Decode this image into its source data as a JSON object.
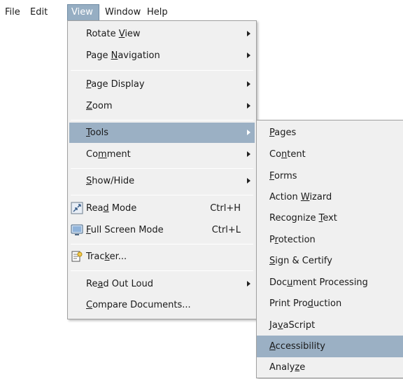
{
  "menubar": {
    "items": [
      {
        "label": "File"
      },
      {
        "label": "Edit"
      },
      {
        "label": "View"
      },
      {
        "label": "Window"
      },
      {
        "label": "Help"
      }
    ]
  },
  "view_menu": {
    "items": [
      {
        "label": "Rotate View",
        "has_submenu": true
      },
      {
        "label": "Page Navigation",
        "has_submenu": true
      },
      {
        "label": "Page Display",
        "has_submenu": true
      },
      {
        "label": "Zoom",
        "has_submenu": true
      },
      {
        "label": "Tools",
        "has_submenu": true,
        "highlighted": true
      },
      {
        "label": "Comment",
        "has_submenu": true
      },
      {
        "label": "Show/Hide",
        "has_submenu": true
      },
      {
        "label": "Read Mode",
        "shortcut": "Ctrl+H",
        "icon": "read-mode-icon"
      },
      {
        "label": "Full Screen Mode",
        "shortcut": "Ctrl+L",
        "icon": "full-screen-icon"
      },
      {
        "label": "Tracker...",
        "icon": "tracker-icon"
      },
      {
        "label": "Read Out Loud",
        "has_submenu": true
      },
      {
        "label": "Compare Documents..."
      }
    ]
  },
  "tools_submenu": {
    "items": [
      {
        "label": "Pages"
      },
      {
        "label": "Content"
      },
      {
        "label": "Forms"
      },
      {
        "label": "Action Wizard"
      },
      {
        "label": "Recognize Text"
      },
      {
        "label": "Protection"
      },
      {
        "label": "Sign & Certify"
      },
      {
        "label": "Document Processing"
      },
      {
        "label": "Print Production"
      },
      {
        "label": "JavaScript"
      },
      {
        "label": "Accessibility",
        "highlighted": true
      },
      {
        "label": "Analyze"
      }
    ]
  },
  "colors": {
    "menu_bg": "#f0f0f0",
    "highlight": "#9bb0c4",
    "active_menubar": "#96aec3"
  }
}
